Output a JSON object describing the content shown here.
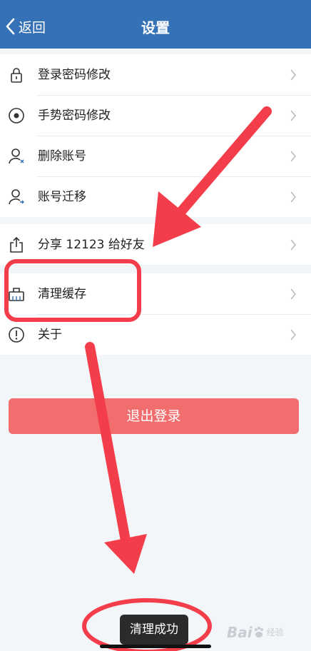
{
  "header": {
    "back_label": "返回",
    "title": "设置"
  },
  "groups": [
    {
      "items": [
        {
          "label": "登录密码修改",
          "icon": "lock-icon"
        },
        {
          "label": "手势密码修改",
          "icon": "target-icon"
        },
        {
          "label": "删除账号",
          "icon": "user-remove-icon"
        },
        {
          "label": "账号迁移",
          "icon": "user-migrate-icon"
        }
      ]
    },
    {
      "items": [
        {
          "label": "分享 12123 给好友",
          "icon": "share-icon"
        }
      ]
    },
    {
      "items": [
        {
          "label": "清理缓存",
          "icon": "broom-icon"
        },
        {
          "label": "关于",
          "icon": "info-icon"
        }
      ]
    }
  ],
  "logout_label": "退出登录",
  "toast": "清理成功",
  "watermark": {
    "logo": "Bai",
    "text": "经验"
  },
  "colors": {
    "header": "#3471b6",
    "logout": "#f26e6e",
    "annotation": "#f43d4a",
    "toast": "#2b2b2b"
  }
}
